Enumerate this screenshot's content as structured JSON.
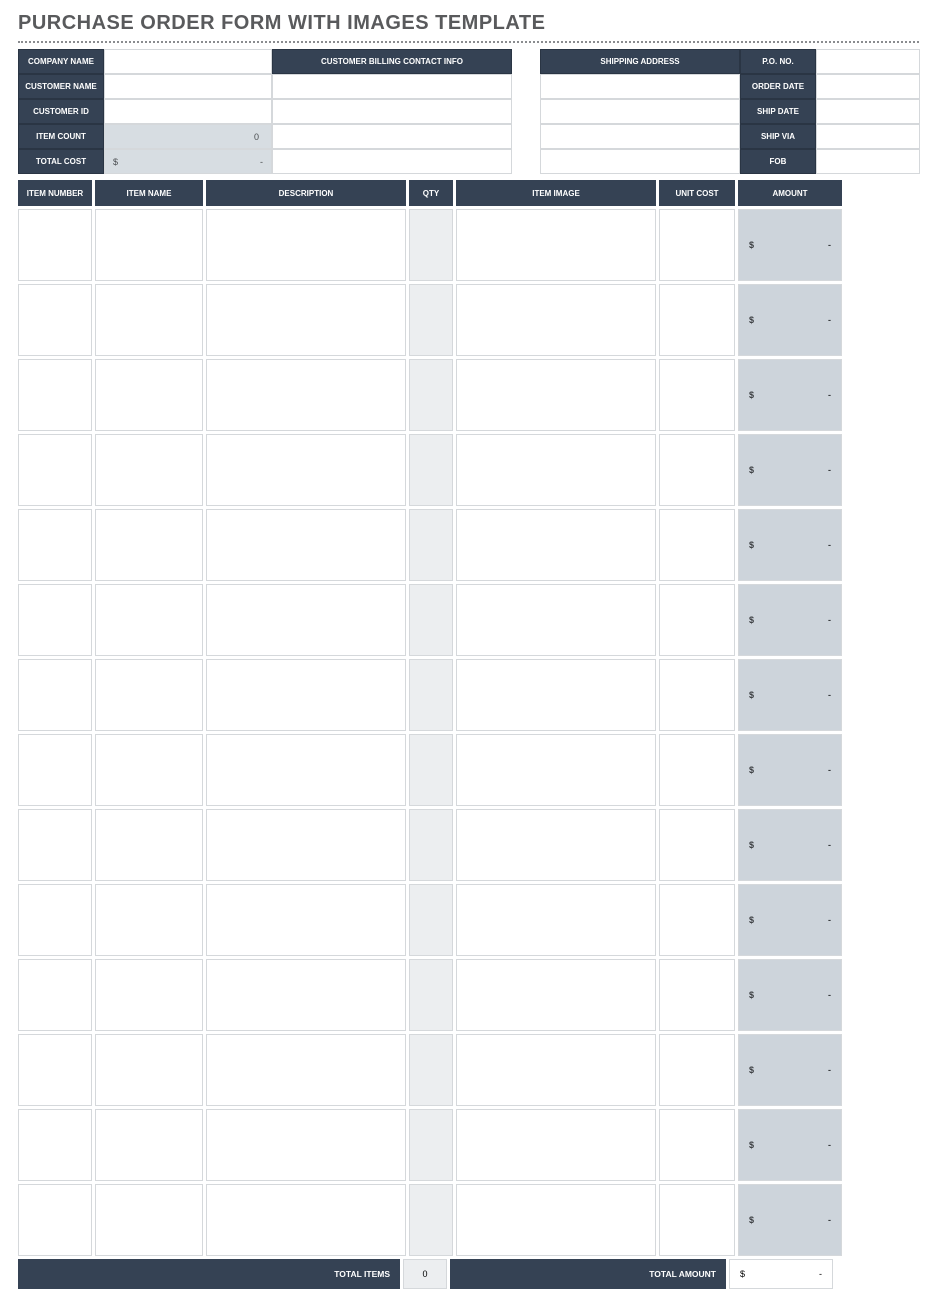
{
  "title": "PURCHASE ORDER FORM WITH IMAGES TEMPLATE",
  "header": {
    "company_name_label": "COMPANY NAME",
    "customer_name_label": "CUSTOMER NAME",
    "customer_id_label": "CUSTOMER ID",
    "item_count_label": "ITEM COUNT",
    "total_cost_label": "TOTAL COST",
    "billing_contact_label": "CUSTOMER BILLING CONTACT INFO",
    "shipping_address_label": "SHIPPING ADDRESS",
    "po_no_label": "P.O. NO.",
    "order_date_label": "ORDER DATE",
    "ship_date_label": "SHIP DATE",
    "ship_via_label": "SHIP VIA",
    "fob_label": "FOB",
    "company_name": "",
    "customer_name": "",
    "customer_id": "",
    "item_count": "0",
    "total_cost_symbol": "$",
    "total_cost_value": "-",
    "billing_r1": "",
    "billing_r2": "",
    "billing_r3": "",
    "billing_r4": "",
    "billing_r5": "",
    "shipping_r1": "",
    "shipping_r2": "",
    "shipping_r3": "",
    "shipping_r4": "",
    "shipping_r5": "",
    "po_no": "",
    "order_date": "",
    "ship_date": "",
    "ship_via": "",
    "fob": ""
  },
  "columns": {
    "item_number": "ITEM NUMBER",
    "item_name": "ITEM NAME",
    "description": "DESCRIPTION",
    "qty": "QTY",
    "item_image": "ITEM IMAGE",
    "unit_cost": "UNIT COST",
    "amount": "AMOUNT"
  },
  "rows": [
    {
      "item_number": "",
      "item_name": "",
      "description": "",
      "qty": "",
      "item_image": "",
      "unit_cost": "",
      "amount_symbol": "$",
      "amount_value": "-"
    },
    {
      "item_number": "",
      "item_name": "",
      "description": "",
      "qty": "",
      "item_image": "",
      "unit_cost": "",
      "amount_symbol": "$",
      "amount_value": "-"
    },
    {
      "item_number": "",
      "item_name": "",
      "description": "",
      "qty": "",
      "item_image": "",
      "unit_cost": "",
      "amount_symbol": "$",
      "amount_value": "-"
    },
    {
      "item_number": "",
      "item_name": "",
      "description": "",
      "qty": "",
      "item_image": "",
      "unit_cost": "",
      "amount_symbol": "$",
      "amount_value": "-"
    },
    {
      "item_number": "",
      "item_name": "",
      "description": "",
      "qty": "",
      "item_image": "",
      "unit_cost": "",
      "amount_symbol": "$",
      "amount_value": "-"
    },
    {
      "item_number": "",
      "item_name": "",
      "description": "",
      "qty": "",
      "item_image": "",
      "unit_cost": "",
      "amount_symbol": "$",
      "amount_value": "-"
    },
    {
      "item_number": "",
      "item_name": "",
      "description": "",
      "qty": "",
      "item_image": "",
      "unit_cost": "",
      "amount_symbol": "$",
      "amount_value": "-"
    },
    {
      "item_number": "",
      "item_name": "",
      "description": "",
      "qty": "",
      "item_image": "",
      "unit_cost": "",
      "amount_symbol": "$",
      "amount_value": "-"
    },
    {
      "item_number": "",
      "item_name": "",
      "description": "",
      "qty": "",
      "item_image": "",
      "unit_cost": "",
      "amount_symbol": "$",
      "amount_value": "-"
    },
    {
      "item_number": "",
      "item_name": "",
      "description": "",
      "qty": "",
      "item_image": "",
      "unit_cost": "",
      "amount_symbol": "$",
      "amount_value": "-"
    },
    {
      "item_number": "",
      "item_name": "",
      "description": "",
      "qty": "",
      "item_image": "",
      "unit_cost": "",
      "amount_symbol": "$",
      "amount_value": "-"
    },
    {
      "item_number": "",
      "item_name": "",
      "description": "",
      "qty": "",
      "item_image": "",
      "unit_cost": "",
      "amount_symbol": "$",
      "amount_value": "-"
    },
    {
      "item_number": "",
      "item_name": "",
      "description": "",
      "qty": "",
      "item_image": "",
      "unit_cost": "",
      "amount_symbol": "$",
      "amount_value": "-"
    },
    {
      "item_number": "",
      "item_name": "",
      "description": "",
      "qty": "",
      "item_image": "",
      "unit_cost": "",
      "amount_symbol": "$",
      "amount_value": "-"
    }
  ],
  "totals": {
    "total_items_label": "TOTAL ITEMS",
    "total_items_value": "0",
    "total_amount_label": "TOTAL AMOUNT",
    "total_amount_symbol": "$",
    "total_amount_value": "-"
  }
}
